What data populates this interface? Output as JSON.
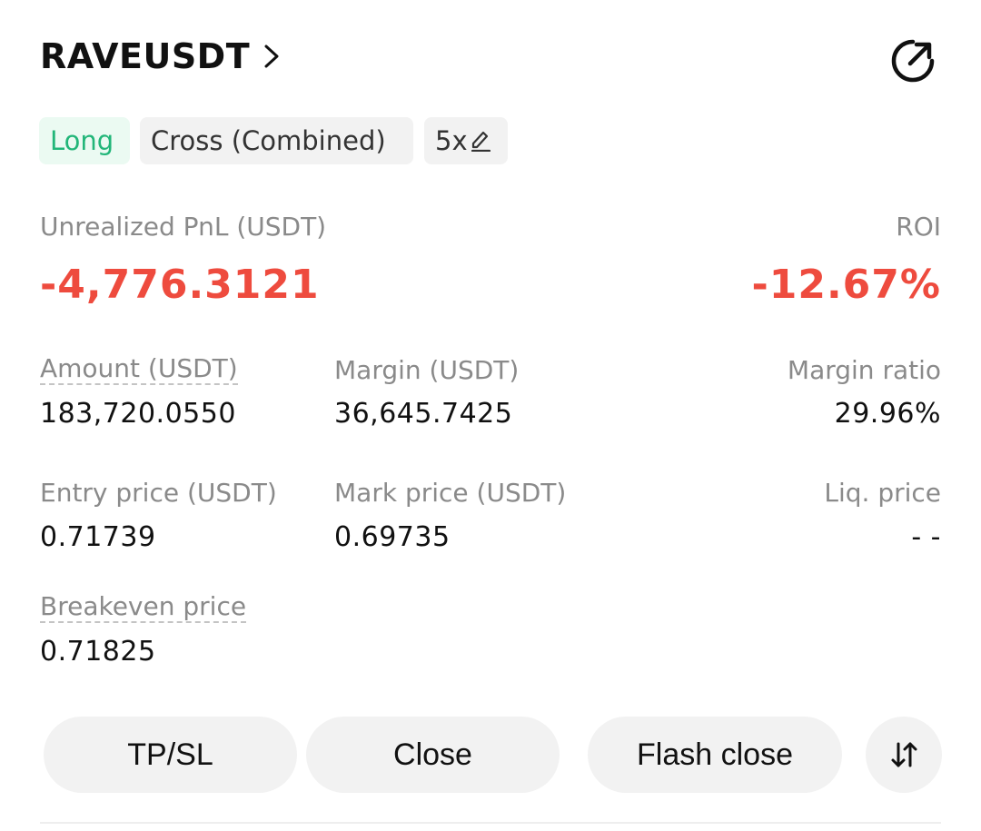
{
  "header": {
    "symbol": "RAVEUSDT",
    "chevron_icon": "chevron-right-icon",
    "share_icon": "share-icon"
  },
  "tags": {
    "side": "Long",
    "margin_mode": "Cross (Combined)",
    "leverage": "5x",
    "edit_icon": "pencil-icon"
  },
  "pnl": {
    "label": "Unrealized PnL (USDT)",
    "value": "-4,776.3121",
    "roi_label": "ROI",
    "roi_value": "-12.67%"
  },
  "details": {
    "amount_label": "Amount (USDT)",
    "amount_value": "183,720.0550",
    "margin_label": "Margin (USDT)",
    "margin_value": "36,645.7425",
    "margin_ratio_label": "Margin ratio",
    "margin_ratio_value": "29.96%",
    "entry_label": "Entry price (USDT)",
    "entry_value": "0.71739",
    "mark_label": "Mark price (USDT)",
    "mark_value": "0.69735",
    "liq_label": "Liq. price",
    "liq_value": "- -",
    "breakeven_label": "Breakeven price",
    "breakeven_value": "0.71825"
  },
  "actions": {
    "tpsl": "TP/SL",
    "close": "Close",
    "flash_close": "Flash close",
    "reverse_icon": "swap-arrows-icon"
  },
  "colors": {
    "loss": "#ee4b3e",
    "long": "#22b679",
    "long_bg": "#ebfaf2",
    "chip_bg": "#f2f2f2"
  }
}
